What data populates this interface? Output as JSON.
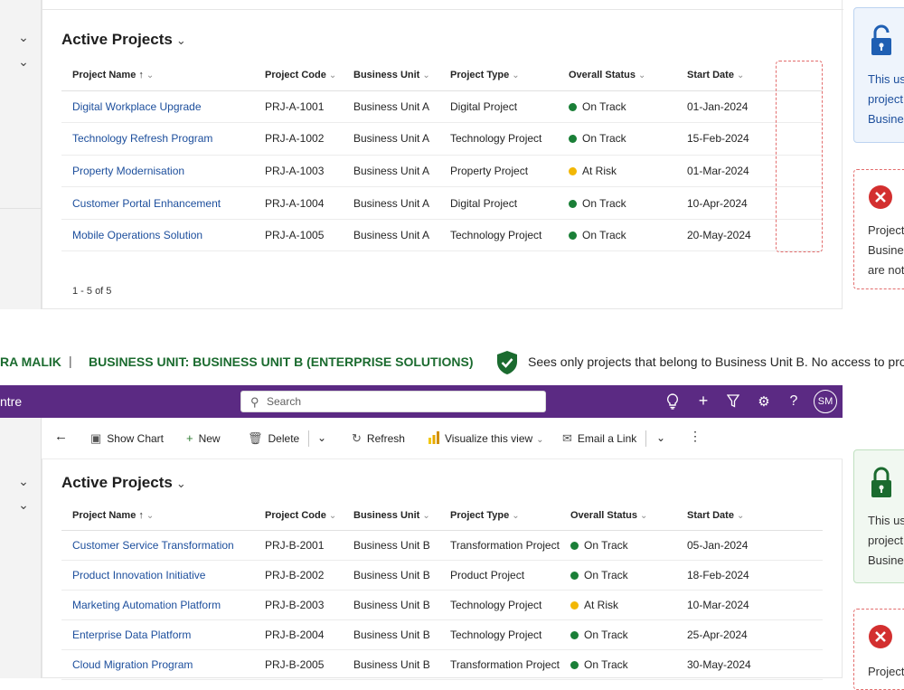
{
  "top_view": {
    "title": "Active Projects",
    "columns": [
      "Project Name ↑",
      "Project Code",
      "Business Unit",
      "Project Type",
      "Overall Status",
      "Start Date"
    ],
    "rows": [
      {
        "name": "Digital Workplace Upgrade",
        "code": "PRJ-A-1001",
        "unit": "Business Unit A",
        "type": "Digital Project",
        "status": "On Track",
        "status_color": "#1a7f37",
        "date": "01-Jan-2024"
      },
      {
        "name": "Technology Refresh Program",
        "code": "PRJ-A-1002",
        "unit": "Business Unit A",
        "type": "Technology Project",
        "status": "On Track",
        "status_color": "#1a7f37",
        "date": "15-Feb-2024"
      },
      {
        "name": "Property Modernisation",
        "code": "PRJ-A-1003",
        "unit": "Business Unit A",
        "type": "Property Project",
        "status": "At Risk",
        "status_color": "#f2b705",
        "date": "01-Mar-2024"
      },
      {
        "name": "Customer Portal Enhancement",
        "code": "PRJ-A-1004",
        "unit": "Business Unit A",
        "type": "Digital Project",
        "status": "On Track",
        "status_color": "#1a7f37",
        "date": "10-Apr-2024"
      },
      {
        "name": "Mobile Operations Solution",
        "code": "PRJ-A-1005",
        "unit": "Business Unit A",
        "type": "Technology Project",
        "status": "On Track",
        "status_color": "#1a7f37",
        "date": "20-May-2024"
      }
    ],
    "pager": "1 - 5 of 5",
    "info_card_lines": [
      "This us",
      "project",
      "Busine"
    ],
    "error_card_lines": [
      "Project",
      "Busine",
      "are not"
    ]
  },
  "banner": {
    "user": "RA MALIK",
    "separator": "|",
    "business_unit": "BUSINESS UNIT:  BUSINESS UNIT B (ENTERPRISE SOLUTIONS)",
    "message": "Sees only projects that belong to Business Unit B. No access to projects"
  },
  "app": {
    "name": "ntre",
    "search_placeholder": "Search",
    "avatar": "SM"
  },
  "commands": {
    "show_chart": "Show Chart",
    "new": "New",
    "delete": "Delete",
    "refresh": "Refresh",
    "visualize": "Visualize this view",
    "email_link": "Email a Link"
  },
  "bottom_view": {
    "title": "Active Projects",
    "columns": [
      "Project Name ↑",
      "Project Code",
      "Business Unit",
      "Project Type",
      "Overall Status",
      "Start Date"
    ],
    "rows": [
      {
        "name": "Customer Service Transformation",
        "code": "PRJ-B-2001",
        "unit": "Business Unit B",
        "type": "Transformation Project",
        "status": "On Track",
        "status_color": "#1a7f37",
        "date": "05-Jan-2024"
      },
      {
        "name": "Product Innovation Initiative",
        "code": "PRJ-B-2002",
        "unit": "Business Unit B",
        "type": "Product Project",
        "status": "On Track",
        "status_color": "#1a7f37",
        "date": "18-Feb-2024"
      },
      {
        "name": "Marketing Automation Platform",
        "code": "PRJ-B-2003",
        "unit": "Business Unit B",
        "type": "Technology Project",
        "status": "At Risk",
        "status_color": "#f2b705",
        "date": "10-Mar-2024"
      },
      {
        "name": "Enterprise Data Platform",
        "code": "PRJ-B-2004",
        "unit": "Business Unit B",
        "type": "Technology Project",
        "status": "On Track",
        "status_color": "#1a7f37",
        "date": "25-Apr-2024"
      },
      {
        "name": "Cloud Migration Program",
        "code": "PRJ-B-2005",
        "unit": "Business Unit B",
        "type": "Transformation Project",
        "status": "On Track",
        "status_color": "#1a7f37",
        "date": "30-May-2024"
      }
    ],
    "info_card_lines": [
      "This us",
      "project",
      "Busine"
    ],
    "error_card_lines": [
      "Project"
    ]
  }
}
